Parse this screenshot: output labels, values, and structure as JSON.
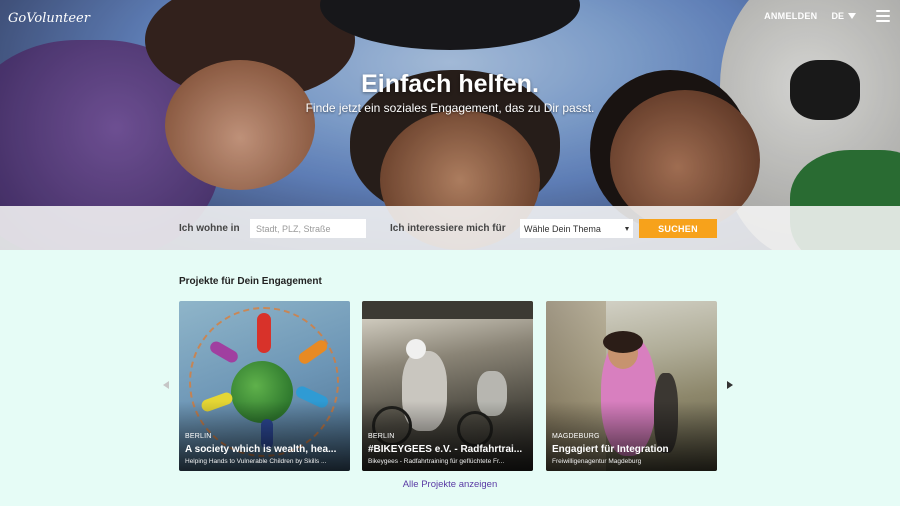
{
  "header": {
    "logo_text": "GoVolunteer",
    "login_label": "ANMELDEN",
    "language": "DE",
    "menu_icon": "hamburger-icon"
  },
  "hero": {
    "title": "Einfach helfen.",
    "subtitle": "Finde jetzt ein soziales Engagement, das zu Dir passt."
  },
  "search": {
    "location_label": "Ich wohne in",
    "location_placeholder": "Stadt, PLZ, Straße",
    "interest_label": "Ich interessiere mich für",
    "topic_selected": "Wähle Dein Thema",
    "submit_label": "SUCHEN",
    "accent_color": "#f7a21b"
  },
  "projects": {
    "section_title": "Projekte für Dein Engagement",
    "cards": [
      {
        "city": "BERLIN",
        "title": "A society which is wealth, hea...",
        "org": "Helping Hands to Vulnerable Children by Skills ..."
      },
      {
        "city": "BERLIN",
        "title": "#BIKEYGEES e.V. - Radfahrtrai...",
        "org": "Bikeygees - Radfahrtraining für geflüchtete Fr..."
      },
      {
        "city": "MAGDEBURG",
        "title": "Engagiert für Integration",
        "org": "Freiwilligenagentur Magdeburg"
      }
    ],
    "all_link": "Alle Projekte anzeigen",
    "link_color": "#5a3aa5"
  }
}
